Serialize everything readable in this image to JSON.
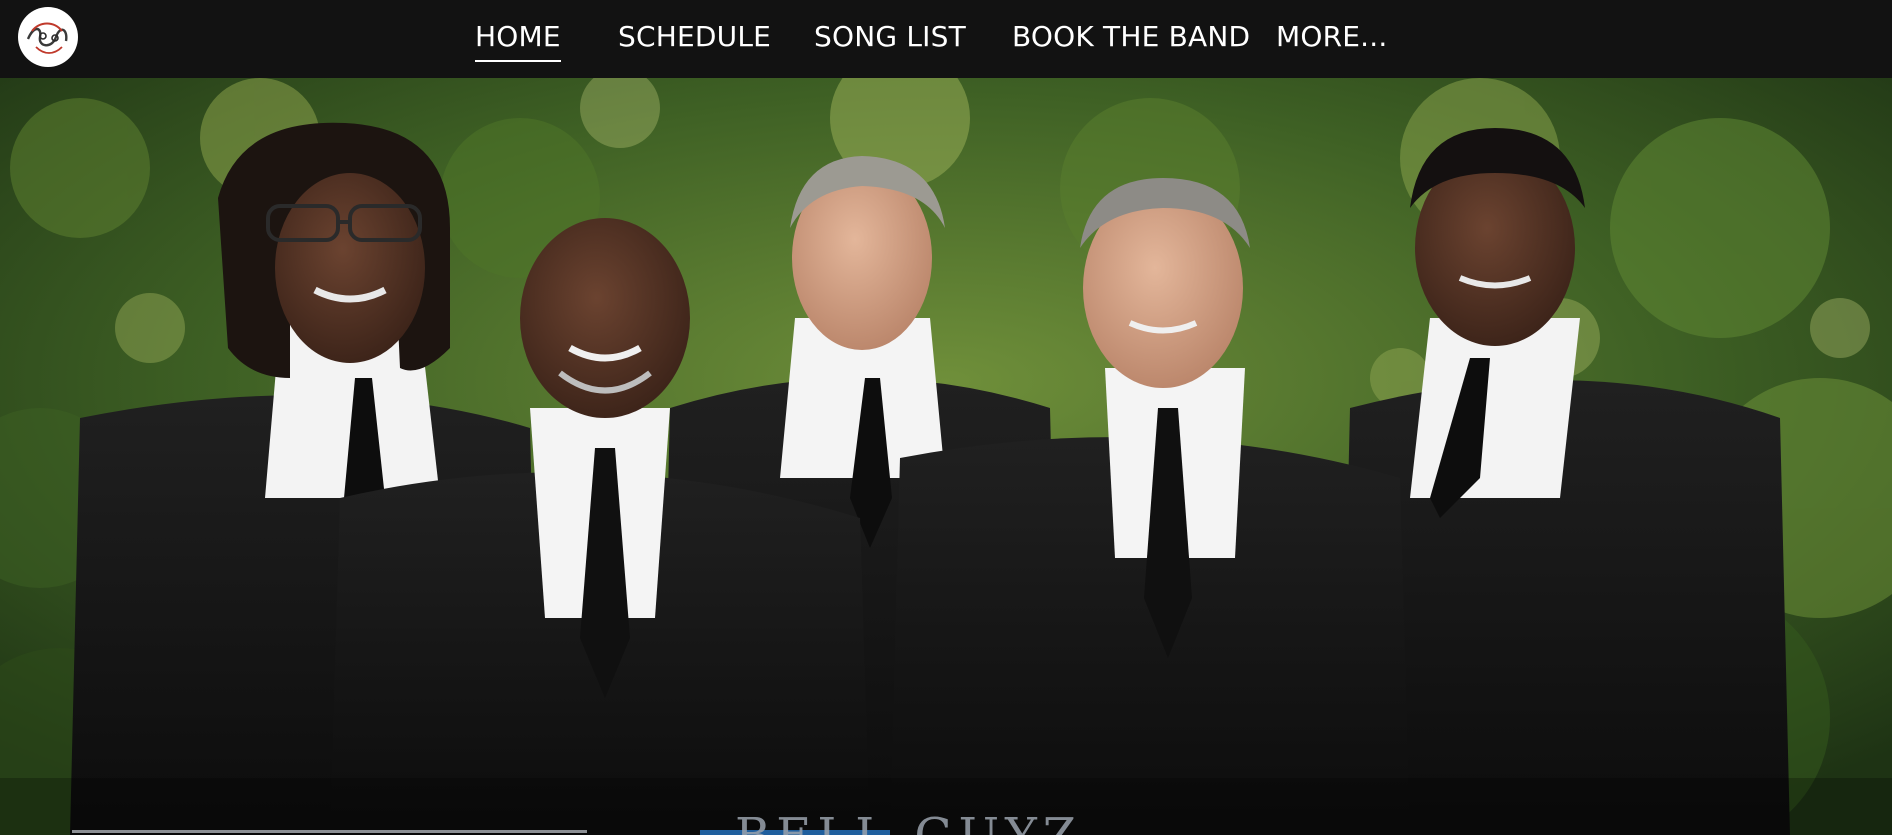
{
  "logo": {
    "icon": "band-logo-icon"
  },
  "nav": {
    "items": [
      {
        "label": "HOME",
        "active": true
      },
      {
        "label": "SCHEDULE",
        "active": false
      },
      {
        "label": "SONG LIST",
        "active": false
      },
      {
        "label": "BOOK THE BAND",
        "active": false
      },
      {
        "label": "MORE...",
        "active": false
      }
    ]
  },
  "hero": {
    "title": "BELL GUYZ",
    "image_description_icon": "band-photo-image"
  },
  "colors": {
    "navbar": "#121212",
    "nav_text": "#ffffff",
    "foliage": "#3f6a26",
    "suit": "#141414"
  }
}
